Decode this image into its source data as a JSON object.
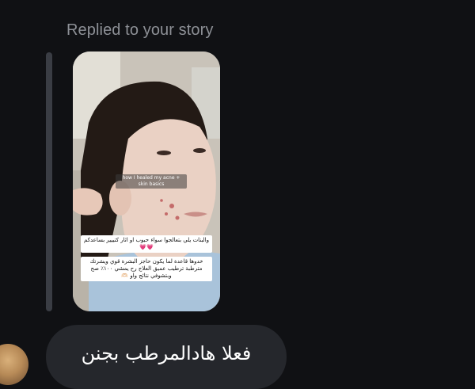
{
  "reply": {
    "header": "Replied to your story"
  },
  "story": {
    "overlay_title": "how I healed my acne + skin basics",
    "caption_line1": "والبنات يلي بتعالجوا سواء حبوب او اثار كتييير بساعدكم 💗💗",
    "caption_line2": "خدوها قاعدة لما يكون حاجز البشرة قوي ويشرتك مترطبة ترطيب عميق العلاج رح يمشي ١٠٠٪ صح وبتشوفي نتائج واو 🫶🏻"
  },
  "message": {
    "text": "فعلا هادالمرطب بجنن"
  },
  "colors": {
    "background": "#101114",
    "bubble": "#25272c",
    "header_text": "#8d9096",
    "reply_bar": "#3a3d44"
  },
  "icons": {
    "avatar": "profile-avatar"
  }
}
